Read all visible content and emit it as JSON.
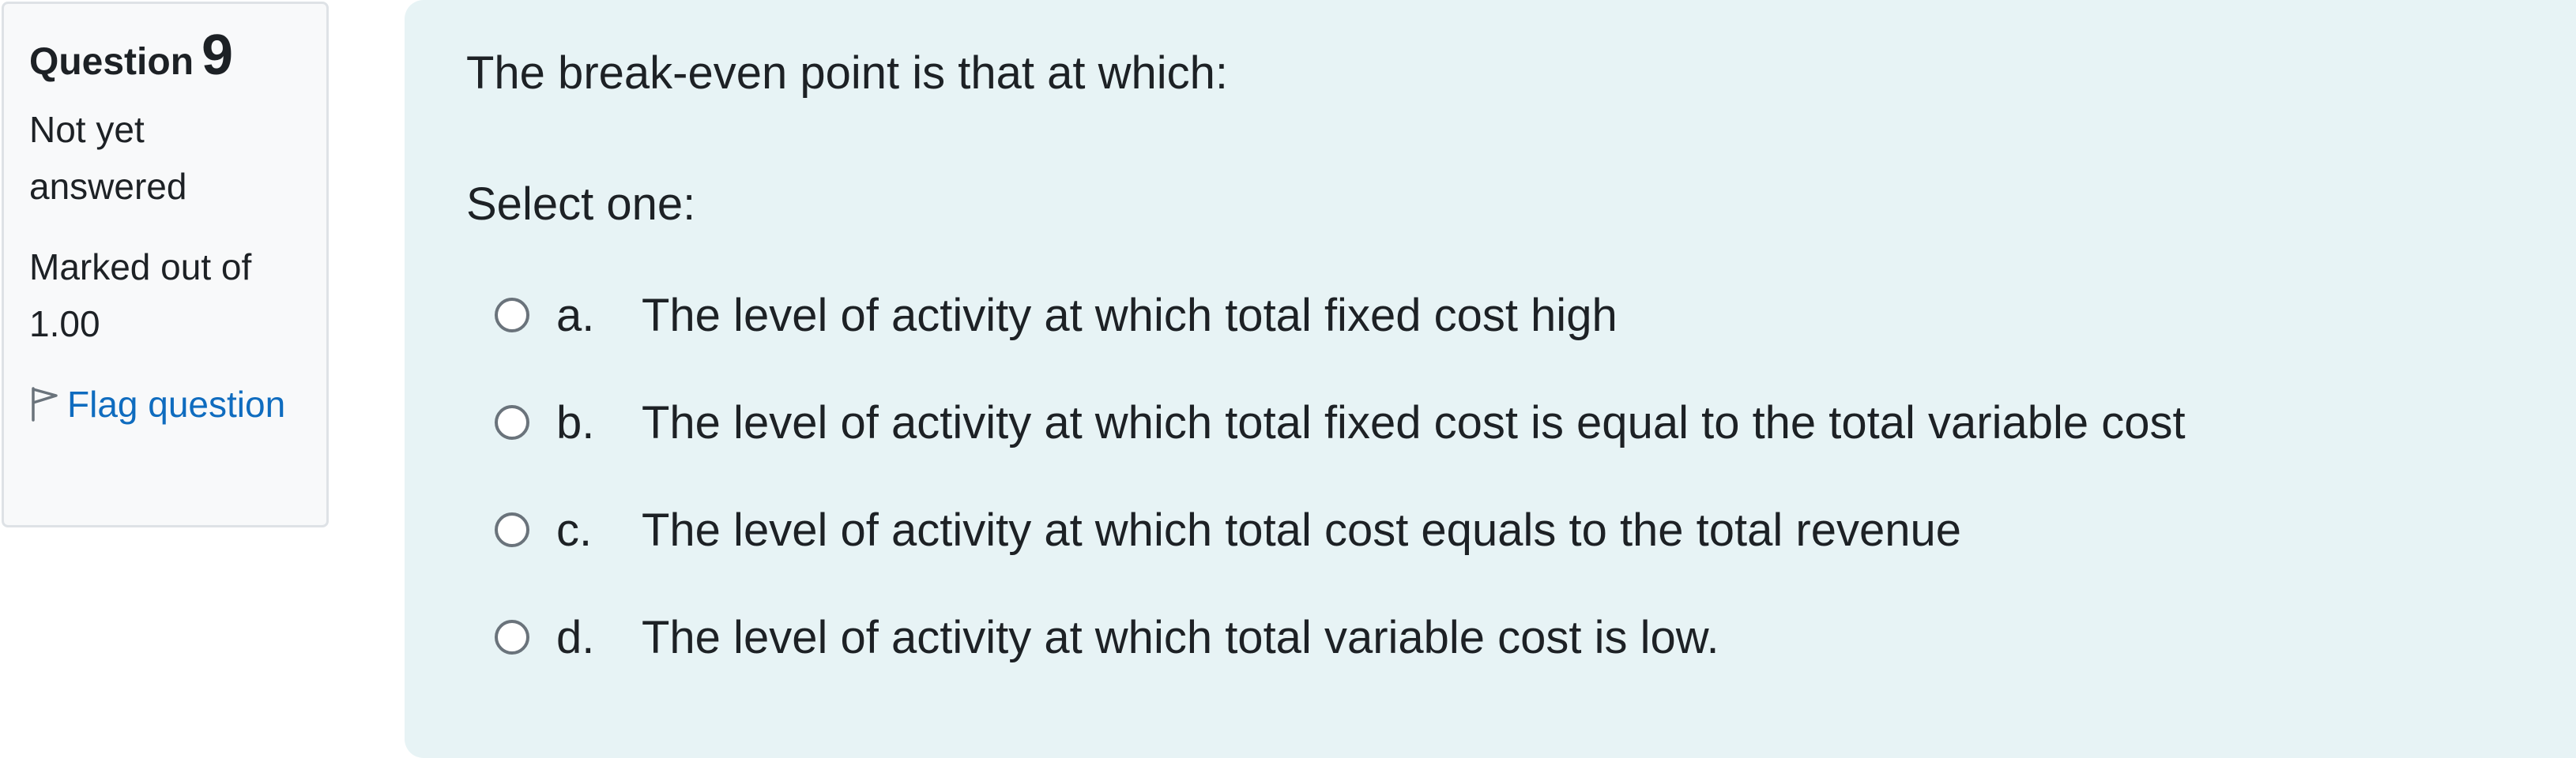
{
  "info": {
    "question_label": "Question",
    "question_number": "9",
    "state": "Not yet answered",
    "grade": "Marked out of 1.00",
    "flag_label": "Flag question",
    "flag_icon": "flag-outline-icon"
  },
  "question": {
    "text": "The break-even point is that at which:",
    "prompt": "Select one:",
    "answers": [
      {
        "letter": "a.",
        "text": "The level of activity at which total fixed cost high",
        "selected": false
      },
      {
        "letter": "b.",
        "text": "The level of activity at which total fixed cost is equal to the total variable cost",
        "selected": false
      },
      {
        "letter": "c.",
        "text": "The level of activity at which total cost equals to the total revenue",
        "selected": false
      },
      {
        "letter": "d.",
        "text": "The level of activity at which total variable cost is low.",
        "selected": false
      }
    ]
  },
  "colors": {
    "info_bg": "#f8f9fa",
    "info_border": "#dee2e6",
    "content_bg": "#e7f3f5",
    "link": "#0f6cbf",
    "text": "#1d2125",
    "radio_border": "#6a737b"
  }
}
